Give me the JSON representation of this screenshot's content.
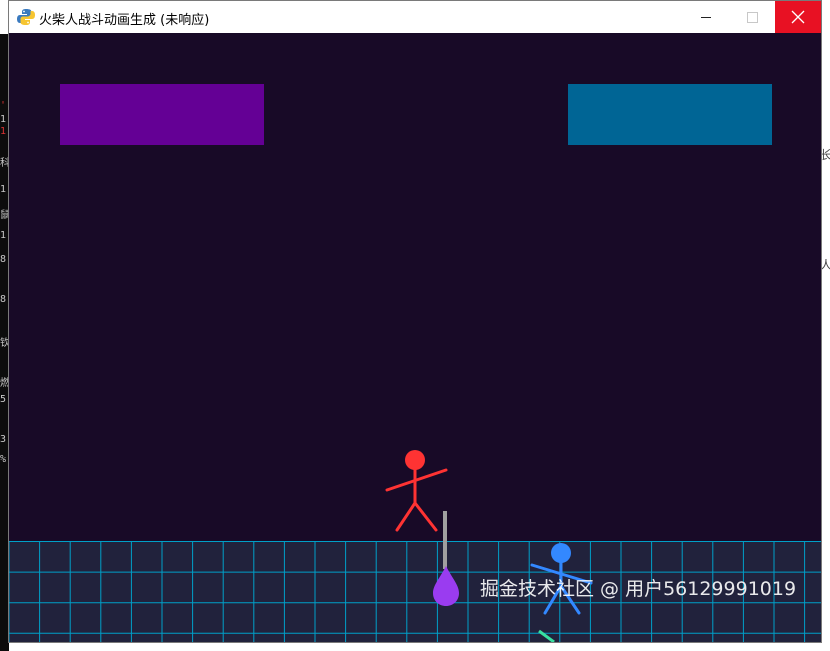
{
  "window": {
    "title": "火柴人战斗动画生成 (未响应)",
    "app_icon": "python-snake-icon"
  },
  "controls": {
    "minimize_icon": "minimize-icon",
    "maximize_icon": "maximize-icon",
    "close_icon": "close-icon",
    "close_color": "#e81123"
  },
  "game": {
    "background_color": "#180a27",
    "player1": {
      "color": "#ff3333",
      "health_bar_color": "#640095"
    },
    "player2": {
      "color": "#3388ff",
      "health_bar_color": "#006595"
    },
    "floor": {
      "fill": "#21223c",
      "grid_color": "#00a0c8"
    },
    "weapon": {
      "shaft_color": "#a0a0a0",
      "blade_color": "#9a3cf0"
    }
  },
  "watermark": "掘金技术社区 @ 用户56129991019"
}
